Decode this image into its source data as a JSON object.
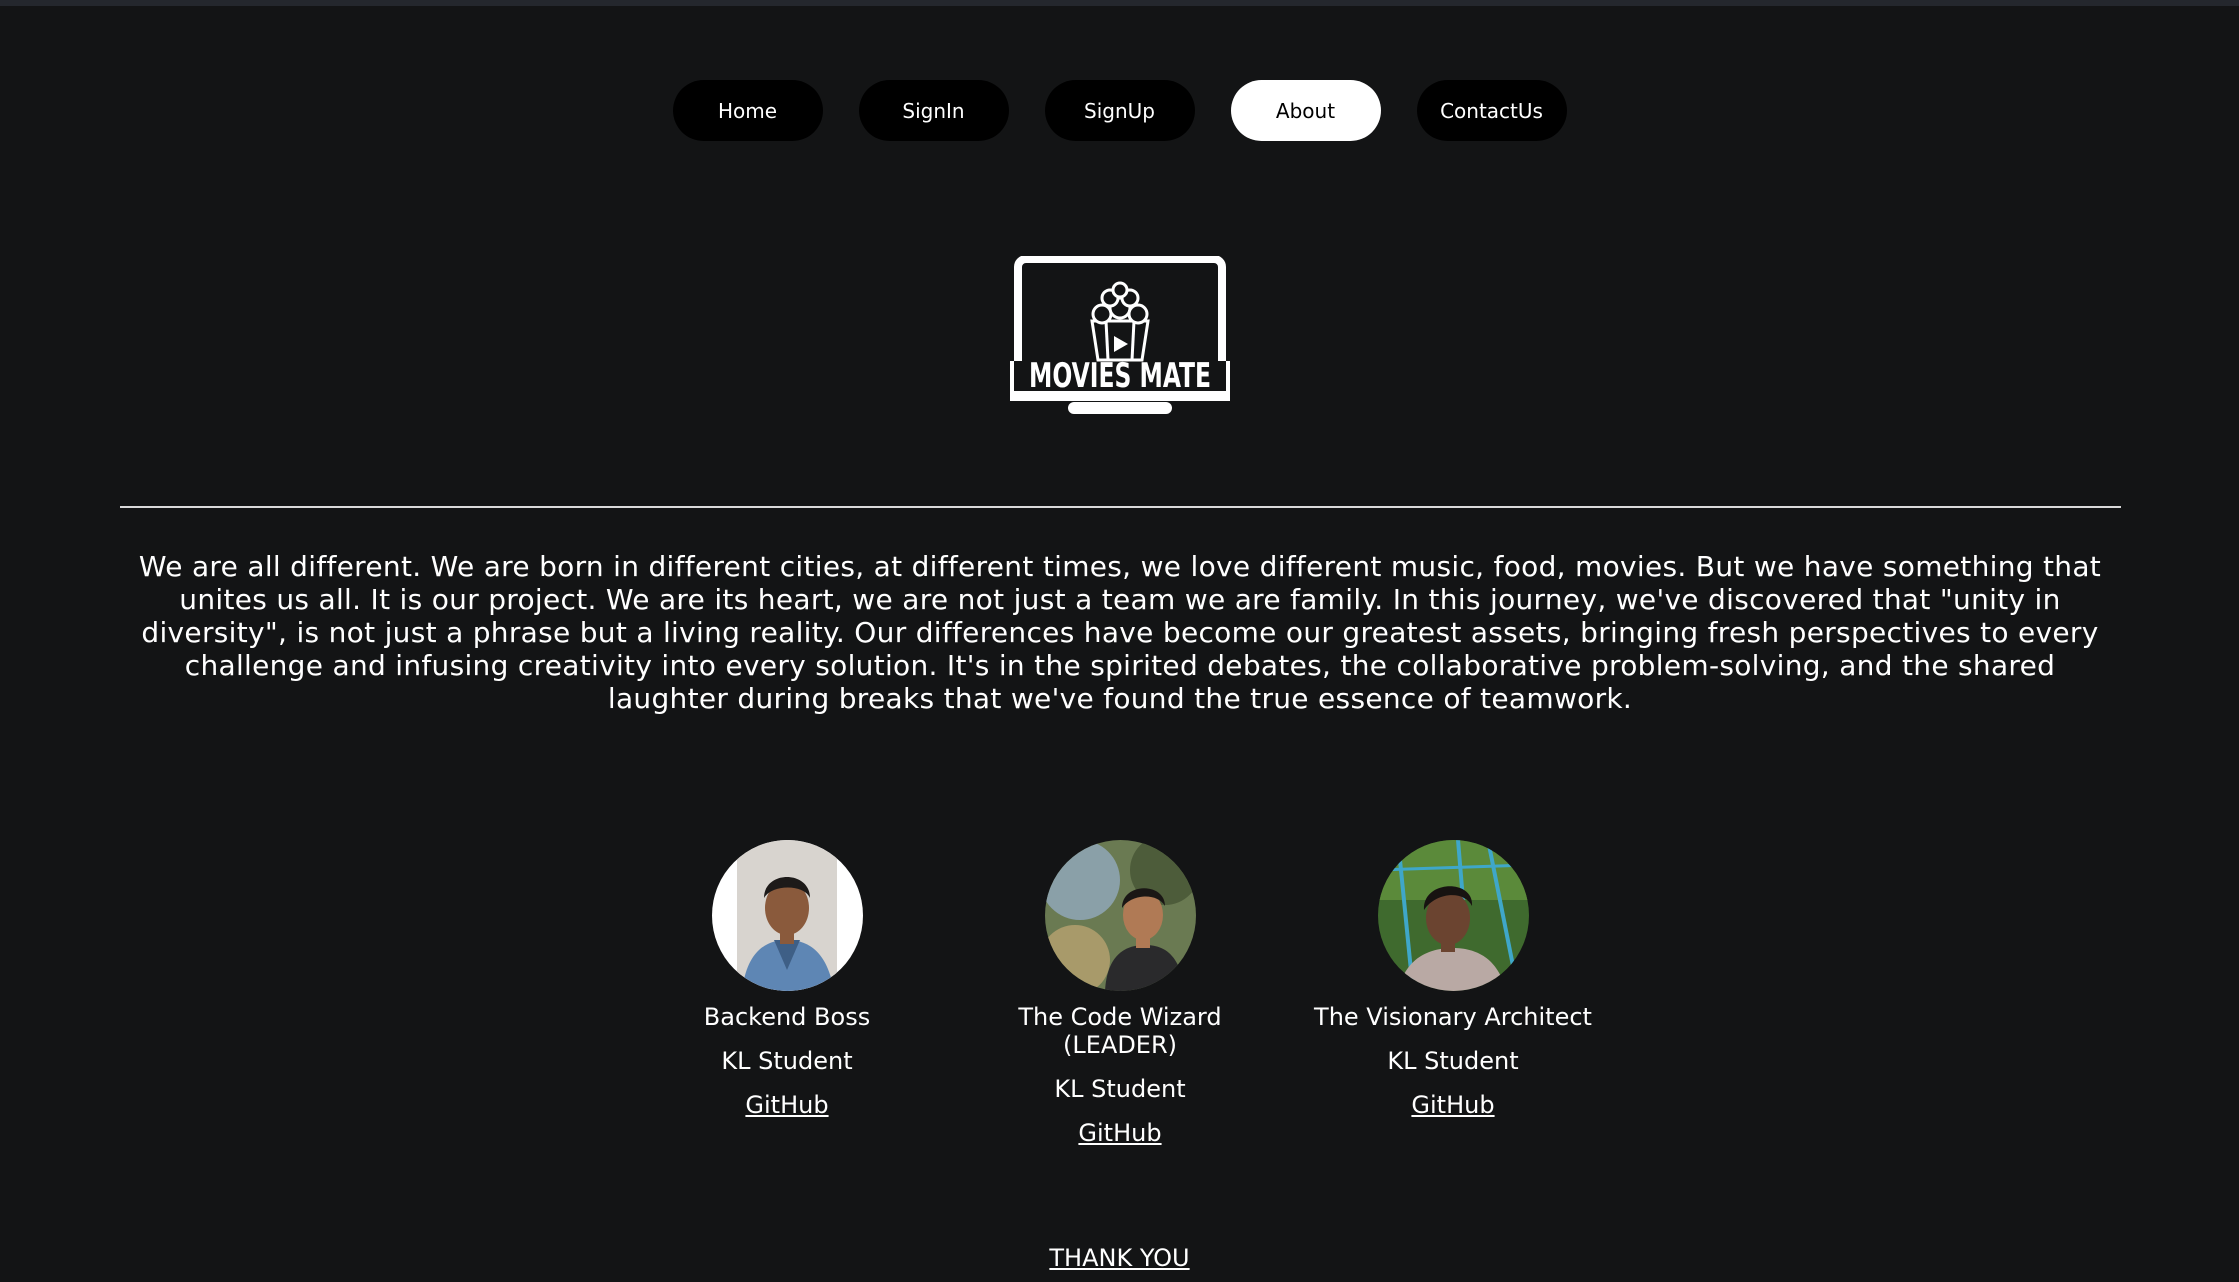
{
  "nav": {
    "items": [
      {
        "label": "Home",
        "active": false
      },
      {
        "label": "SignIn",
        "active": false
      },
      {
        "label": "SignUp",
        "active": false
      },
      {
        "label": "About",
        "active": true
      },
      {
        "label": "ContactUs",
        "active": false
      }
    ]
  },
  "logo": {
    "text": "MOVIES MATE",
    "icon": "popcorn-laptop-icon"
  },
  "about": {
    "text": "We are all different. We are born in different cities, at different times, we love different music, food, movies. But we have something that unites us all. It is our project. We are its heart, we are not just a team we are family. In this journey, we've discovered that \"unity in diversity\", is not just a phrase but a living reality. Our differences have become our greatest assets, bringing fresh perspectives to every challenge and infusing creativity into every solution. It's in the spirited debates, the collaborative problem-solving, and the shared laughter during breaks that we've found the true essence of teamwork."
  },
  "team": [
    {
      "role": "Backend Boss",
      "org": "KL Student",
      "link": "GitHub"
    },
    {
      "role": "The Code Wizard (LEADER)",
      "org": "KL Student",
      "link": "GitHub"
    },
    {
      "role": "The Visionary Architect",
      "org": "KL Student",
      "link": "GitHub"
    }
  ],
  "footer": {
    "thank_you": "THANK YOU"
  },
  "colors": {
    "background": "#131415",
    "nav_button": "#000000",
    "nav_active": "#ffffff",
    "text": "#ffffff"
  }
}
